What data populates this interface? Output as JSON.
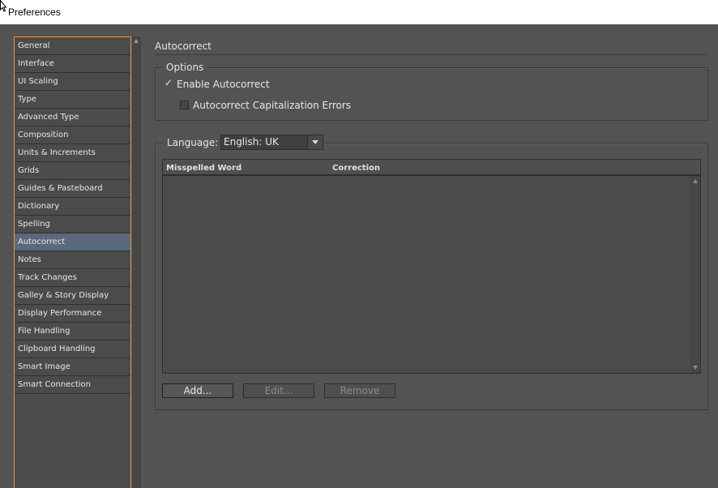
{
  "window": {
    "title": "Preferences"
  },
  "sidebar": {
    "items": [
      {
        "label": "General"
      },
      {
        "label": "Interface"
      },
      {
        "label": "UI Scaling"
      },
      {
        "label": "Type"
      },
      {
        "label": "Advanced Type"
      },
      {
        "label": "Composition"
      },
      {
        "label": "Units & Increments"
      },
      {
        "label": "Grids"
      },
      {
        "label": "Guides & Pasteboard"
      },
      {
        "label": "Dictionary"
      },
      {
        "label": "Spelling"
      },
      {
        "label": "Autocorrect",
        "selected": true
      },
      {
        "label": "Notes"
      },
      {
        "label": "Track Changes"
      },
      {
        "label": "Galley & Story Display"
      },
      {
        "label": "Display Performance"
      },
      {
        "label": "File Handling"
      },
      {
        "label": "Clipboard Handling"
      },
      {
        "label": "Smart Image"
      },
      {
        "label": "Smart Connection"
      }
    ]
  },
  "main": {
    "section_title": "Autocorrect",
    "options": {
      "legend": "Options",
      "enable_autocorrect": {
        "label": "Enable Autocorrect",
        "checked": true
      },
      "capitalization_errors": {
        "label": "Autocorrect Capitalization Errors",
        "checked": false
      }
    },
    "language": {
      "label": "Language:",
      "selected": "English: UK"
    },
    "table": {
      "columns": [
        "Misspelled Word",
        "Correction"
      ],
      "rows": []
    },
    "buttons": {
      "add": "Add...",
      "edit": "Edit...",
      "remove": "Remove"
    }
  },
  "colors": {
    "background": "#535353",
    "selection": "#5a6a7c",
    "sidebar_border": "#e69a3c"
  }
}
